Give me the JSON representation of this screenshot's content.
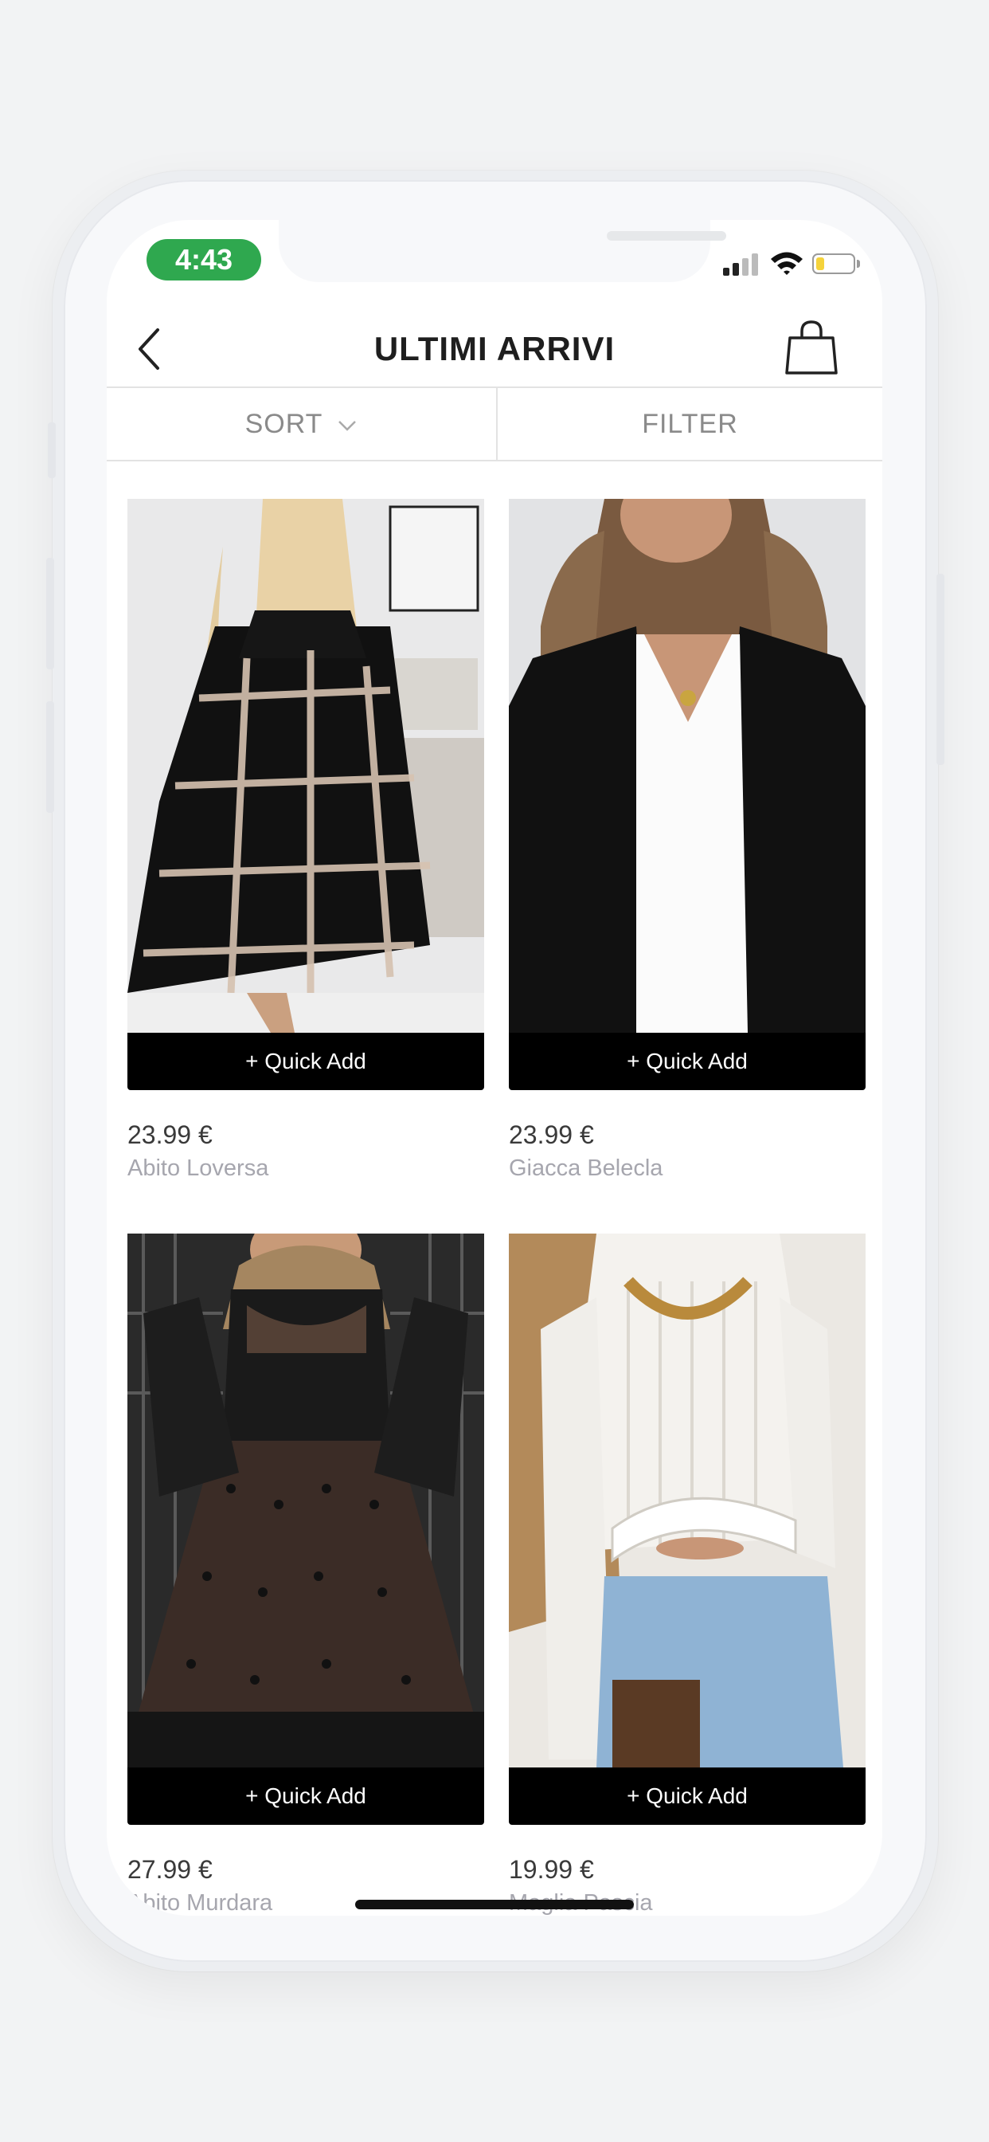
{
  "status_bar": {
    "time": "4:43"
  },
  "header": {
    "title": "ULTIMI ARRIVI"
  },
  "toolbar": {
    "sort_label": "SORT",
    "filter_label": "FILTER"
  },
  "products": [
    {
      "price": "23.99 €",
      "name": "Abito Loversa",
      "quick_add": "+ Quick Add",
      "image": "black-chain-print-shirt-dress-photo"
    },
    {
      "price": "23.99 €",
      "name": "Giacca Belecla",
      "quick_add": "+ Quick Add",
      "image": "black-blazer-white-top-photo"
    },
    {
      "price": "27.99 €",
      "name": "Abito Murdara",
      "quick_add": "+ Quick Add",
      "image": "black-polka-dot-lace-dress-photo"
    },
    {
      "price": "19.99 €",
      "name": "Maglia Pascia",
      "quick_add": "+ Quick Add",
      "image": "white-ribbed-crop-top-photo"
    }
  ],
  "colors": {
    "accent_green": "#2fa84f",
    "button_black": "#000000",
    "price_text": "#3a3a3a",
    "name_text": "#a6a6ae"
  }
}
